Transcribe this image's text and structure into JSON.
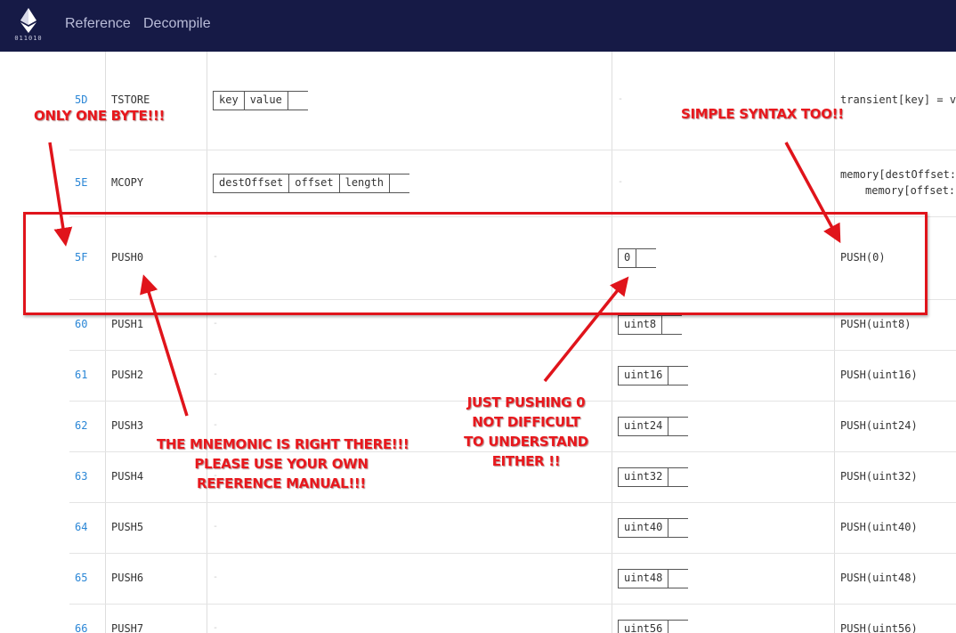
{
  "header": {
    "logo_text": "011010",
    "nav": [
      "Reference",
      "Decompile"
    ]
  },
  "rows": [
    {
      "opcode": "5D",
      "name": "TSTORE",
      "input": [
        "key",
        "value"
      ],
      "output": [],
      "expression": "transient[key] = v",
      "expression2": ""
    },
    {
      "opcode": "5E",
      "name": "MCOPY",
      "input": [
        "destOffset",
        "offset",
        "length"
      ],
      "output": [],
      "expression": "memory[destOffset:",
      "expression2": "memory[offset:"
    },
    {
      "opcode": "5F",
      "name": "PUSH0",
      "input": [],
      "output": [
        "0"
      ],
      "expression": "PUSH(0)",
      "expression2": ""
    },
    {
      "opcode": "60",
      "name": "PUSH1",
      "input": [],
      "output": [
        "uint8"
      ],
      "expression": "PUSH(uint8)",
      "expression2": ""
    },
    {
      "opcode": "61",
      "name": "PUSH2",
      "input": [],
      "output": [
        "uint16"
      ],
      "expression": "PUSH(uint16)",
      "expression2": ""
    },
    {
      "opcode": "62",
      "name": "PUSH3",
      "input": [],
      "output": [
        "uint24"
      ],
      "expression": "PUSH(uint24)",
      "expression2": ""
    },
    {
      "opcode": "63",
      "name": "PUSH4",
      "input": [],
      "output": [
        "uint32"
      ],
      "expression": "PUSH(uint32)",
      "expression2": ""
    },
    {
      "opcode": "64",
      "name": "PUSH5",
      "input": [],
      "output": [
        "uint40"
      ],
      "expression": "PUSH(uint40)",
      "expression2": ""
    },
    {
      "opcode": "65",
      "name": "PUSH6",
      "input": [],
      "output": [
        "uint48"
      ],
      "expression": "PUSH(uint48)",
      "expression2": ""
    },
    {
      "opcode": "66",
      "name": "PUSH7",
      "input": [],
      "output": [
        "uint56"
      ],
      "expression": "PUSH(uint56)",
      "expression2": ""
    }
  ],
  "empty_marker": "-",
  "annotations": {
    "only_one_byte": "ONLY ONE BYTE!!!",
    "simple_syntax": "SIMPLE SYNTAX TOO!!",
    "mnemonic_1": "THE MNEMONIC IS RIGHT THERE!!!",
    "mnemonic_2": "PLEASE USE YOUR OWN",
    "mnemonic_3": "REFERENCE MANUAL!!!",
    "push0_1": "JUST PUSHING 0",
    "push0_2": "NOT DIFFICULT",
    "push0_3": "TO UNDERSTAND",
    "push0_4": "EITHER !!"
  },
  "colors": {
    "header_bg": "#161a46",
    "opcode_link": "#2a86d6",
    "annotation_red": "#e0141b"
  }
}
